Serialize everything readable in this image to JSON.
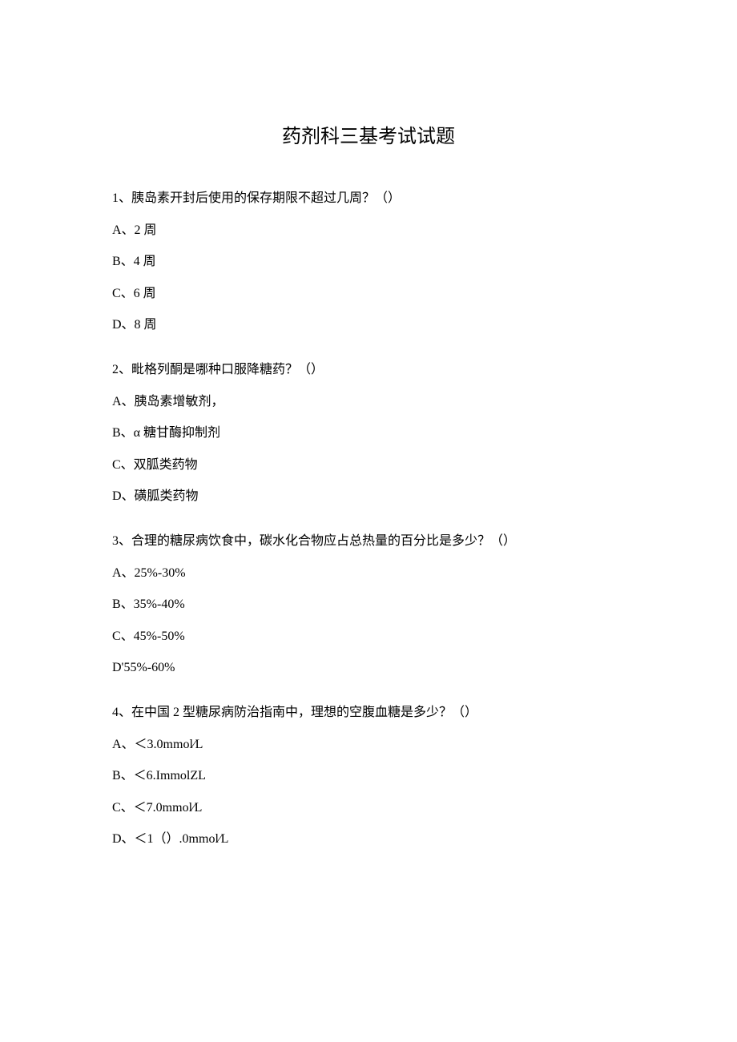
{
  "title": "药剂科三基考试试题",
  "questions": [
    {
      "text": "1、胰岛素开封后使用的保存期限不超过几周？（）",
      "options": [
        "A、2 周",
        "B、4 周",
        "C、6 周",
        "D、8 周"
      ]
    },
    {
      "text": "2、毗格列酮是哪种口服降糖药？（）",
      "options": [
        "A、胰岛素增敏剂，",
        "B、α 糖甘酶抑制剂",
        "C、双胍类药物",
        "D、磺胍类药物"
      ]
    },
    {
      "text": "3、合理的糖尿病饮食中，碳水化合物应占总热量的百分比是多少？（）",
      "options": [
        "A、25%-30%",
        "B、35%-40%",
        "C、45%-50%",
        "D'55%-60%"
      ]
    },
    {
      "text": "4、在中国 2 型糖尿病防治指南中，理想的空腹血糖是多少？（）",
      "options": [
        "A、＜3.0mmol∕L",
        "B、＜6.ImmolZL",
        "C、＜7.0mmol∕L",
        "D、＜1（）.0mmol∕L"
      ]
    }
  ]
}
